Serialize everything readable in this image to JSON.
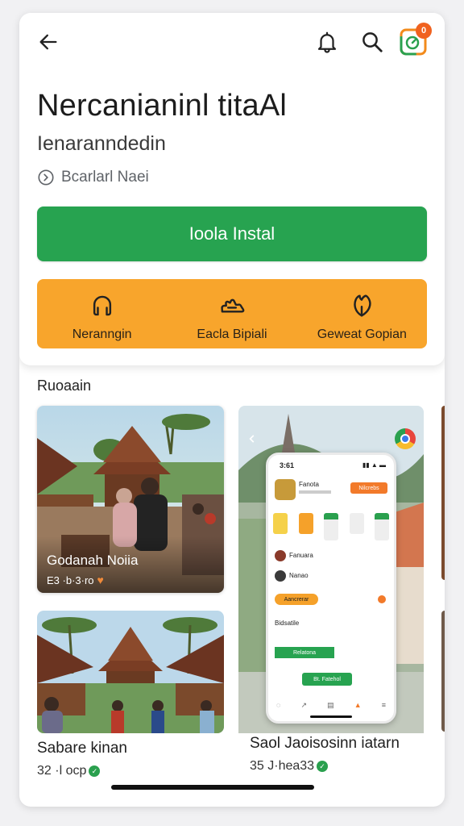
{
  "header": {
    "back_icon": "arrow-left-icon",
    "bell_icon": "bell-icon",
    "search_icon": "search-icon",
    "app_icon_badge": "0"
  },
  "app": {
    "title": "Nercanianinl titaAl",
    "subtitle": "Ienaranndedin",
    "meta": "Bcarlarl Naei"
  },
  "install_button": {
    "label": "Ioola Instal"
  },
  "features": [
    {
      "icon": "phone-handset-icon",
      "label": "Neranngin"
    },
    {
      "icon": "cloud-hand-icon",
      "label": "Eacla Bipiali"
    },
    {
      "icon": "leaf-icon",
      "label": "Geweat Gopian"
    }
  ],
  "section": {
    "title": "Ruoaain"
  },
  "cards": [
    {
      "overlay_title": "Godanah Noiia",
      "overlay_meta": "E3 ·b·3·ro"
    },
    {
      "title": "Sabare kinan",
      "meta": "32 ·l ocp"
    },
    {
      "title": "Saol Jaoisosinn iatarn",
      "meta": "35 J·hea33"
    }
  ],
  "phone_mock": {
    "time": "3:61",
    "row1_title": "Fanota",
    "row1_button": "Nilcrebs",
    "list_item1": "Fanuara",
    "list_item2": "Nanao",
    "pill_label": "Aancrerar",
    "footer_label": "Bidsatile",
    "green_bar": "Relatona",
    "btn_label": "Bt. Fatehol"
  },
  "colors": {
    "green": "#27a350",
    "orange": "#f8a52c",
    "badge": "#f0621f"
  }
}
